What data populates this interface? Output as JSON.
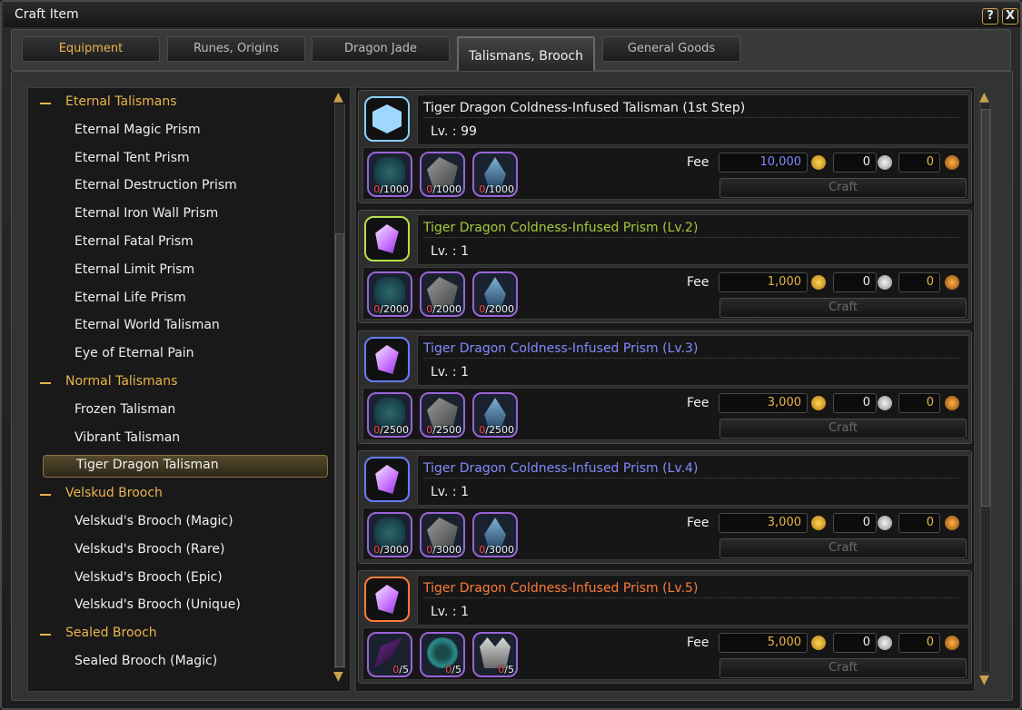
{
  "window": {
    "title": "Craft Item",
    "help_label": "?",
    "close_label": "X"
  },
  "tabs": [
    {
      "label": "Equipment"
    },
    {
      "label": "Runes, Origins"
    },
    {
      "label": "Dragon Jade"
    },
    {
      "label": "Talismans, Brooch"
    },
    {
      "label": "General Goods"
    }
  ],
  "tabs_active_index": 3,
  "sidebar": {
    "categories": [
      {
        "label": "Eternal Talismans",
        "items": [
          "Eternal Magic Prism",
          "Eternal Tent Prism",
          "Eternal Destruction Prism",
          "Eternal Iron Wall Prism",
          "Eternal Fatal Prism",
          "Eternal Limit Prism",
          "Eternal Life Prism",
          "Eternal World Talisman",
          "Eye of Eternal Pain"
        ]
      },
      {
        "label": "Normal Talismans",
        "items": [
          "Frozen Talisman",
          "Vibrant Talisman",
          "Tiger Dragon Talisman"
        ]
      },
      {
        "label": "Velskud Brooch",
        "items": [
          "Velskud's Brooch (Magic)",
          "Velskud's Brooch (Rare)",
          "Velskud's Brooch (Epic)",
          "Velskud's Brooch (Unique)"
        ]
      },
      {
        "label": "Sealed Brooch",
        "items": [
          "Sealed Brooch (Magic)"
        ]
      }
    ],
    "selected_item": "Tiger Dragon Talisman",
    "scroll_arrow_up": "▲",
    "scroll_arrow_down": "▼"
  },
  "fee_label": "Fee",
  "craft_label": "Craft",
  "recipes": [
    {
      "name": "Tiger Dragon Coldness-Infused Talisman (1st Step)",
      "name_color": "#f0f0f0",
      "level": "Lv. : 99",
      "icon": "snowflake-talisman-icon",
      "materials": [
        {
          "icon": "teal-ore-icon",
          "have": "0",
          "need": "/1000"
        },
        {
          "icon": "gray-stone-icon",
          "have": "0",
          "need": "/1000"
        },
        {
          "icon": "blue-crystal-icon",
          "have": "0",
          "need": "/1000"
        }
      ],
      "fee": {
        "gold": "10,000",
        "gold_color": "#7f8cff",
        "silver": "0",
        "copper": "0"
      }
    },
    {
      "name": "Tiger Dragon Coldness-Infused Prism (Lv.2)",
      "name_color": "#a8c83a",
      "level": "Lv. : 1",
      "icon": "prism-icon",
      "materials": [
        {
          "icon": "teal-ore-icon",
          "have": "0",
          "need": "/2000"
        },
        {
          "icon": "gray-stone-icon",
          "have": "0",
          "need": "/2000"
        },
        {
          "icon": "blue-crystal-icon",
          "have": "0",
          "need": "/2000"
        }
      ],
      "fee": {
        "gold": "1,000",
        "gold_color": "#e9b44c",
        "silver": "0",
        "copper": "0"
      }
    },
    {
      "name": "Tiger Dragon Coldness-Infused Prism (Lv.3)",
      "name_color": "#7f8cff",
      "level": "Lv. : 1",
      "icon": "prism-icon",
      "materials": [
        {
          "icon": "teal-ore-icon",
          "have": "0",
          "need": "/2500"
        },
        {
          "icon": "gray-stone-icon",
          "have": "0",
          "need": "/2500"
        },
        {
          "icon": "blue-crystal-icon",
          "have": "0",
          "need": "/2500"
        }
      ],
      "fee": {
        "gold": "3,000",
        "gold_color": "#e9b44c",
        "silver": "0",
        "copper": "0"
      }
    },
    {
      "name": "Tiger Dragon Coldness-Infused Prism (Lv.4)",
      "name_color": "#7f8cff",
      "level": "Lv. : 1",
      "icon": "prism-icon",
      "materials": [
        {
          "icon": "teal-ore-icon",
          "have": "0",
          "need": "/3000"
        },
        {
          "icon": "gray-stone-icon",
          "have": "0",
          "need": "/3000"
        },
        {
          "icon": "blue-crystal-icon",
          "have": "0",
          "need": "/3000"
        }
      ],
      "fee": {
        "gold": "3,000",
        "gold_color": "#e9b44c",
        "silver": "0",
        "copper": "0"
      }
    },
    {
      "name": "Tiger Dragon Coldness-Infused Prism (Lv.5)",
      "name_color": "#ff7a3a",
      "level": "Lv. : 1",
      "icon": "prism-icon",
      "materials": [
        {
          "icon": "dark-feather-icon",
          "have": "0",
          "need": "/5"
        },
        {
          "icon": "teal-gear-icon",
          "have": "0",
          "need": "/5"
        },
        {
          "icon": "silver-crown-icon",
          "have": "0",
          "need": "/5"
        }
      ],
      "fee": {
        "gold": "5,000",
        "gold_color": "#e9b44c",
        "silver": "0",
        "copper": "0"
      }
    }
  ],
  "colors": {
    "accent_gold": "#e9b44c",
    "rarity_border": "#9a63d6",
    "needed_red": "#ff4a4a"
  }
}
